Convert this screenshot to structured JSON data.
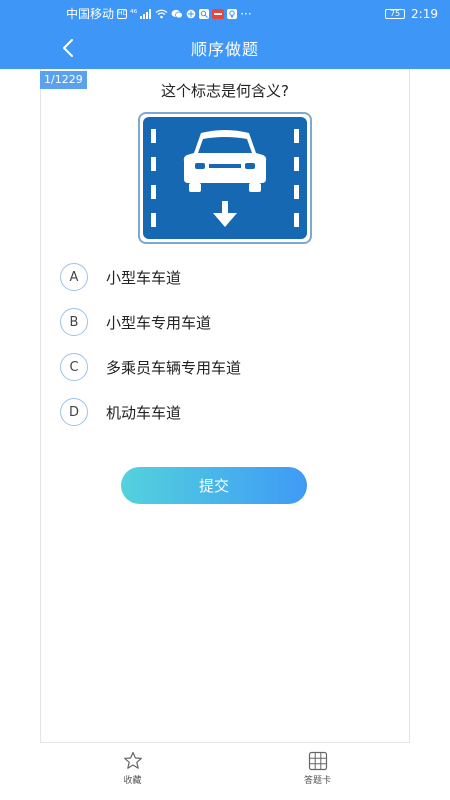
{
  "status_bar": {
    "carrier": "中国移动",
    "network_badge": "HD",
    "signal_text": "⁴⁶",
    "battery": "75",
    "time": "2:19"
  },
  "header": {
    "title": "顺序做题",
    "back_icon": "chevron-left-icon"
  },
  "question": {
    "progress": "1/1229",
    "text": "这个标志是何含义?",
    "sign_image": "small-car-lane-sign"
  },
  "options": [
    {
      "letter": "A",
      "text": "小型车车道"
    },
    {
      "letter": "B",
      "text": "小型车专用车道"
    },
    {
      "letter": "C",
      "text": "多乘员车辆专用车道"
    },
    {
      "letter": "D",
      "text": "机动车车道"
    }
  ],
  "submit_label": "提交",
  "tabbar": {
    "favorite_label": "收藏",
    "answer_card_label": "答题卡"
  },
  "colors": {
    "primary": "#3e97f6",
    "sign_blue": "#1768b3",
    "gradient_start": "#53d2dd",
    "gradient_end": "#3f9af6"
  }
}
